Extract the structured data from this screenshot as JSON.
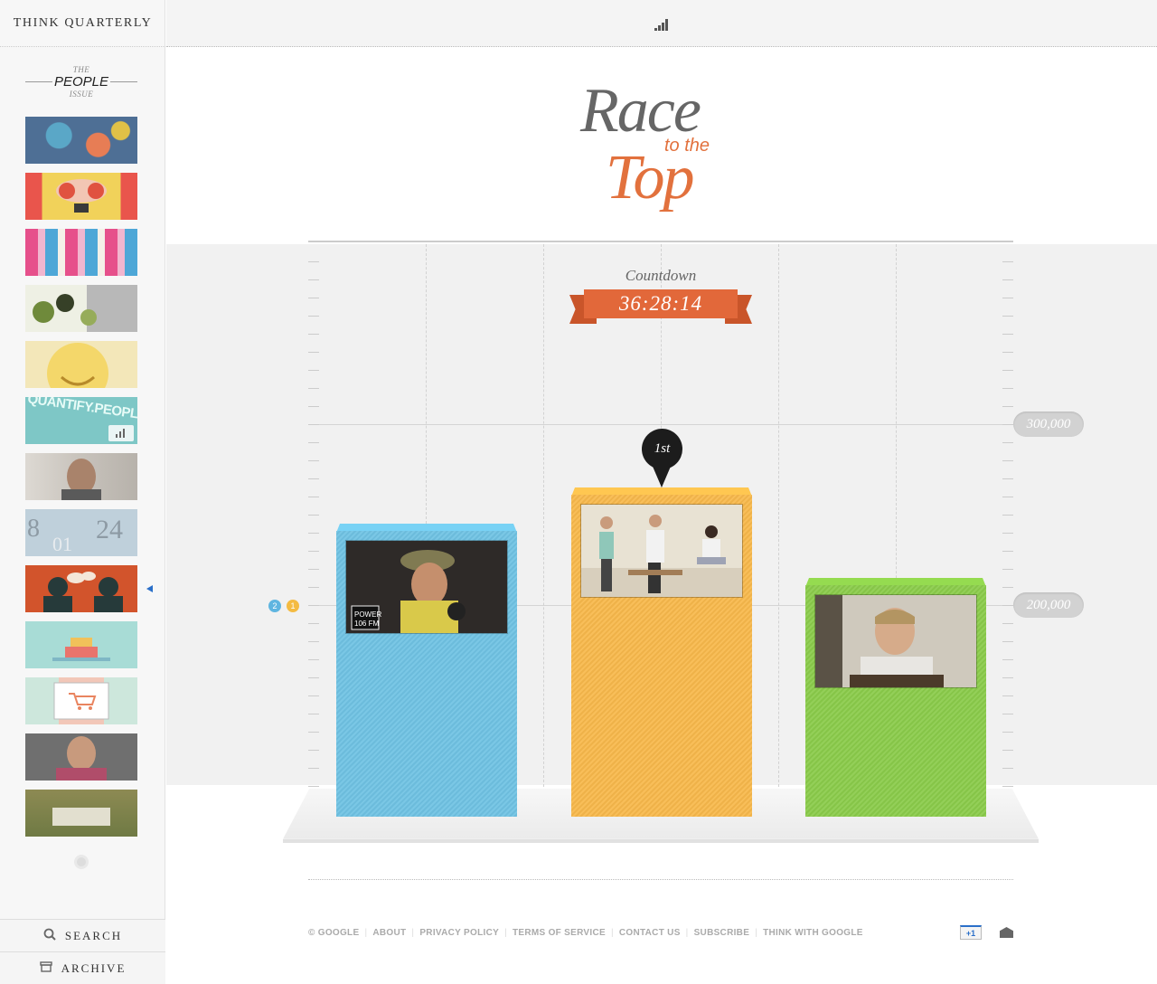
{
  "sidebar": {
    "brand": "THINK QUARTERLY",
    "issue": {
      "pre": "THE",
      "name": "PEOPLE",
      "post": "ISSUE"
    },
    "thumbnail_badge": "QUANTIFY.PEOPL",
    "buttons": {
      "search": "SEARCH",
      "archive": "ARCHIVE"
    }
  },
  "header": {
    "title_race": "Race",
    "title_tothe": "to the",
    "title_top": "Top"
  },
  "countdown": {
    "label": "Countdown",
    "value": "36:28:14"
  },
  "chart_data": {
    "type": "bar",
    "categories": [
      "blue",
      "orange",
      "green"
    ],
    "values": [
      245000,
      265000,
      215000
    ],
    "colors": [
      "#6fc2e3",
      "#f7b84b",
      "#8acb4a"
    ],
    "y_labels": [
      "300,000",
      "200,000"
    ],
    "ylim": [
      115000,
      300000
    ],
    "leader_label": "1st",
    "legend_dots": [
      {
        "text": "2",
        "color": "#5fb5e0"
      },
      {
        "text": "1",
        "color": "#f4bb42"
      }
    ]
  },
  "footer": {
    "links": [
      "© GOOGLE",
      "ABOUT",
      "PRIVACY POLICY",
      "TERMS OF SERVICE",
      "CONTACT US",
      "SUBSCRIBE",
      "THINK WITH GOOGLE"
    ],
    "plusone": "+1"
  },
  "icons": {
    "search": "search-icon",
    "archive": "archive-icon",
    "chart": "bar-chart-icon",
    "mail": "mail-icon"
  }
}
